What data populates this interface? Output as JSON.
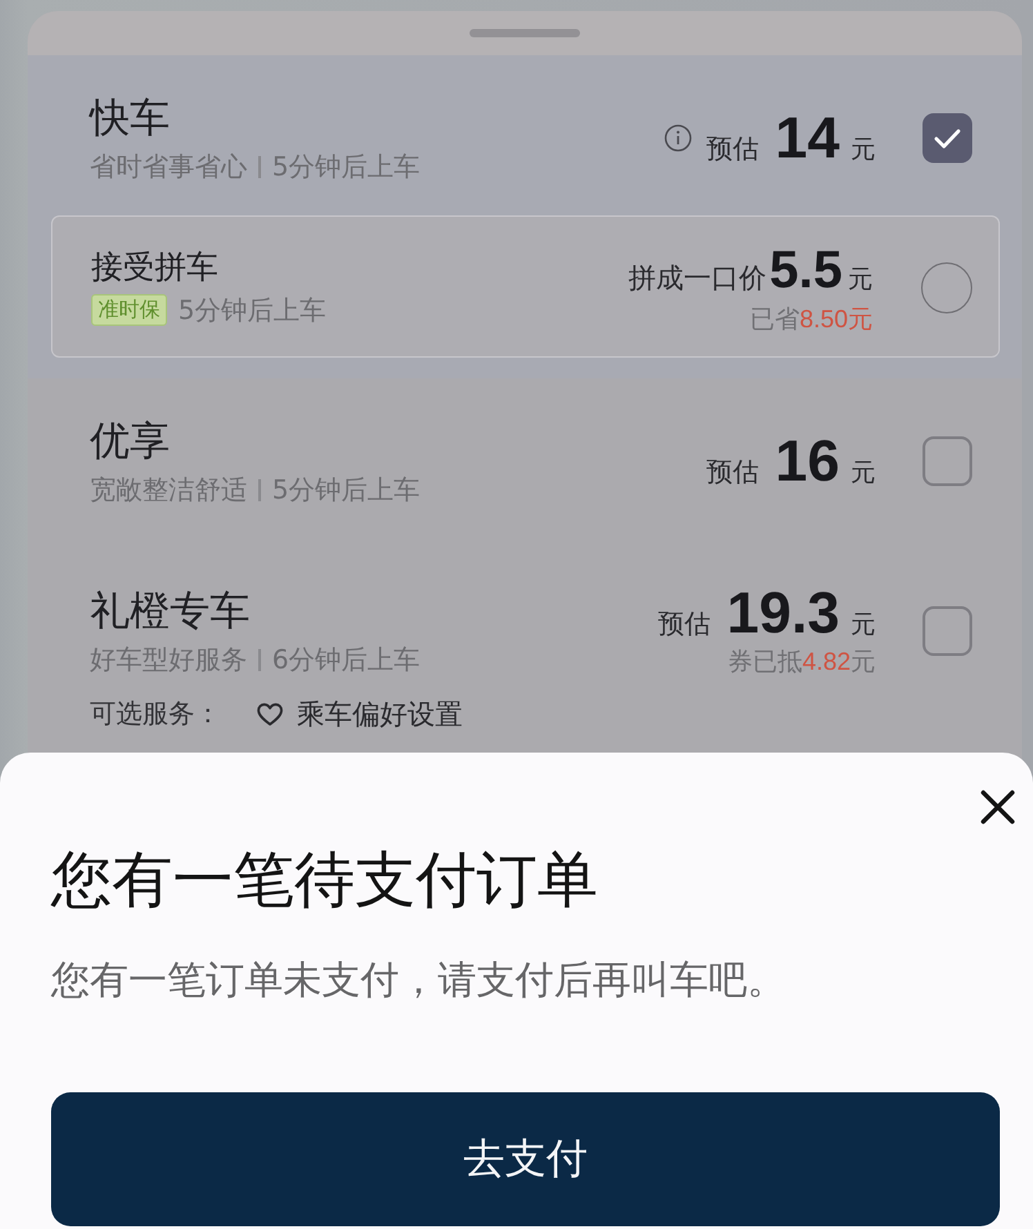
{
  "sheet": {
    "rides": [
      {
        "title": "快车",
        "tagline": "省时省事省心",
        "eta": "5分钟后上车",
        "info": true,
        "price": {
          "prefix": "预估",
          "amount": "14",
          "unit": "元"
        },
        "checked": true,
        "option": {
          "title": "接受拼车",
          "tag": "准时保",
          "eta": "5分钟后上车",
          "price": {
            "prefix": "拼成一口价",
            "amount": "5.5",
            "unit": "元"
          },
          "note": {
            "label": "已省",
            "value": "8.50元"
          },
          "checked": false
        }
      },
      {
        "title": "优享",
        "tagline": "宽敞整洁舒适",
        "eta": "5分钟后上车",
        "price": {
          "prefix": "预估",
          "amount": "16",
          "unit": "元"
        },
        "checked": false
      },
      {
        "title": "礼橙专车",
        "tagline": "好车型好服务",
        "eta": "6分钟后上车",
        "price": {
          "prefix": "预估",
          "amount": "19.3",
          "unit": "元"
        },
        "note": {
          "label": "券已抵",
          "value": "4.82",
          "unit": "元"
        },
        "checked": false,
        "services": {
          "label": "可选服务：",
          "link": "乘车偏好设置"
        }
      }
    ]
  },
  "dialog": {
    "title": "您有一笔待支付订单",
    "message": "您有一笔订单未支付，请支付后再叫车吧。",
    "button": "去支付"
  }
}
